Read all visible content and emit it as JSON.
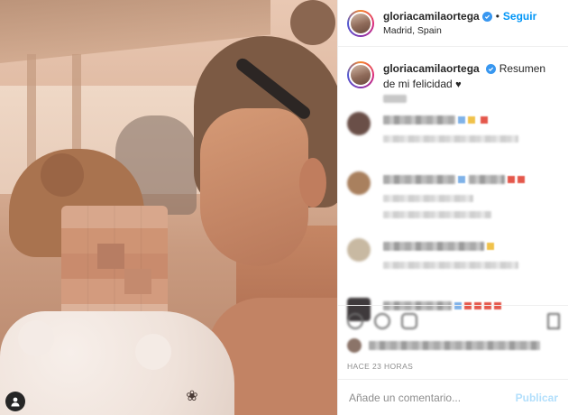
{
  "post": {
    "username": "gloriacamilaortega",
    "location": "Madrid, Spain",
    "follow_label": "Seguir",
    "separator": "•",
    "caption_text": "Resumen de mi felicidad",
    "caption_emoji": "♥",
    "timestamp": "HACE 23 HORAS",
    "photo_flower_glyph": "❀"
  },
  "comment_box": {
    "placeholder": "Añade un comentario...",
    "publish_label": "Publicar"
  },
  "colors": {
    "verified": "#3897f0",
    "follow": "#0095f6",
    "publish_disabled": "#b2dffc"
  },
  "icons": [
    "user-tag-icon",
    "verified-icon",
    "heart-icon",
    "comment-icon",
    "share-icon",
    "save-icon",
    "flower-icon"
  ]
}
